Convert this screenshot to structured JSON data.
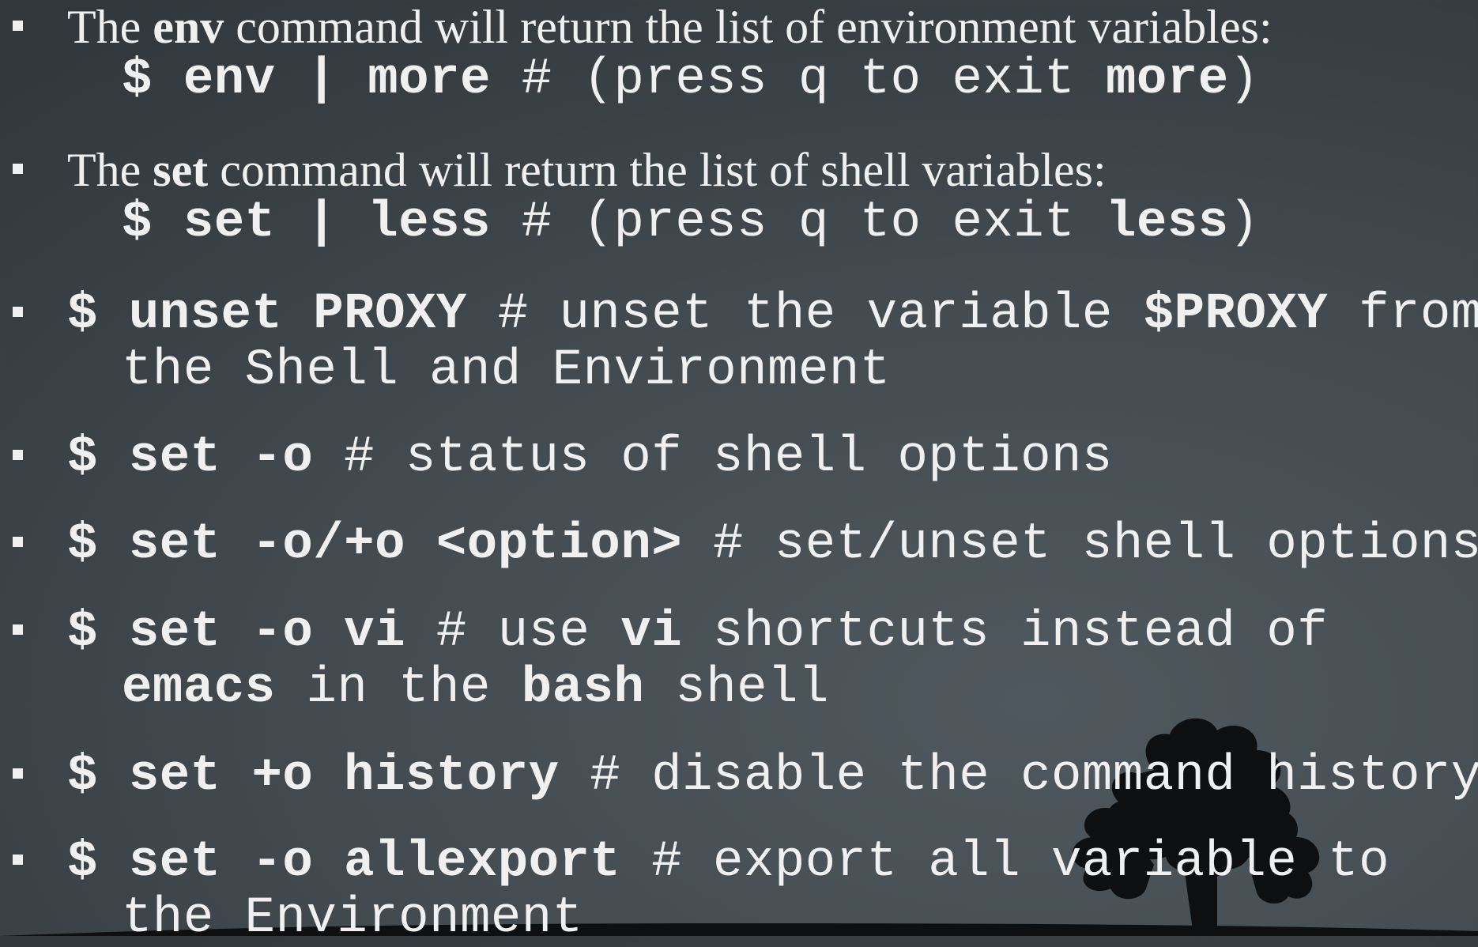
{
  "items": [
    {
      "intro": {
        "pre": "The ",
        "cmd": "env",
        "post": " command will return the list of environment variables:"
      },
      "code": {
        "prompt": "$",
        "cmd": "env | more",
        "comment_pre": "# (press q to exit ",
        "comment_cmd": "more",
        "comment_post": ")"
      }
    },
    {
      "intro": {
        "pre": "The ",
        "cmd": "set",
        "post": " command will return the list of shell variables:"
      },
      "code": {
        "prompt": "$",
        "cmd": "set | less",
        "comment_pre": "# (press q to exit ",
        "comment_cmd": "less",
        "comment_post": ")"
      }
    },
    {
      "cmd": "$ unset PROXY",
      "comment_pre": " # unset the variable ",
      "comment_var": "$PROXY",
      "comment_post": " from",
      "line2": "the Shell and Environment"
    },
    {
      "cmd": "$ set -o",
      "comment": " # status of shell options"
    },
    {
      "cmd": "$ set -o/+o <option>",
      "comment": " # set/unset shell options"
    },
    {
      "cmd": "$ set -o vi",
      "comment_pre": " # use ",
      "comment_vi": "vi",
      "comment_post": " shortcuts instead of",
      "line2_emacs": "emacs",
      "line2_mid": " in the ",
      "line2_bash": "bash",
      "line2_post": " shell"
    },
    {
      "cmd": "$ set +o history",
      "comment": " # disable the command history"
    },
    {
      "cmd": "$ set -o allexport",
      "comment": " # export all variable to",
      "line2": "the Environment"
    }
  ]
}
